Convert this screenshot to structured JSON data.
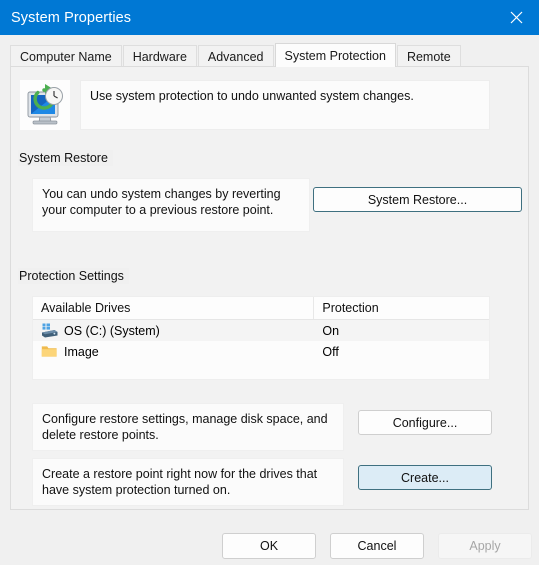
{
  "window": {
    "title": "System Properties",
    "close_icon": "close-icon",
    "titlebar_color": "#0078d4"
  },
  "tabs": [
    {
      "label": "Computer Name",
      "selected": false
    },
    {
      "label": "Hardware",
      "selected": false
    },
    {
      "label": "Advanced",
      "selected": false
    },
    {
      "label": "System Protection",
      "selected": true
    },
    {
      "label": "Remote",
      "selected": false
    }
  ],
  "intro": {
    "icon": "system-protection-icon",
    "text": "Use system protection to undo unwanted system changes."
  },
  "system_restore": {
    "group_label": "System Restore",
    "description": "You can undo system changes by reverting your computer to a previous restore point.",
    "button_label": "System Restore..."
  },
  "protection_settings": {
    "group_label": "Protection Settings",
    "columns": [
      "Available Drives",
      "Protection"
    ],
    "rows": [
      {
        "icon": "hard-drive-icon",
        "name": "OS (C:) (System)",
        "protection": "On"
      },
      {
        "icon": "folder-icon",
        "name": "Image",
        "protection": "Off"
      }
    ],
    "configure": {
      "description": "Configure restore settings, manage disk space, and delete restore points.",
      "button_label": "Configure..."
    },
    "create": {
      "description": "Create a restore point right now for the drives that have system protection turned on.",
      "button_label": "Create..."
    }
  },
  "footer": {
    "ok_label": "OK",
    "cancel_label": "Cancel",
    "apply_label": "Apply",
    "apply_disabled": true
  },
  "colors": {
    "accent": "#0078d4",
    "button_border_accent": "#3f7080",
    "focused_button_fill": "#dcecf6"
  }
}
